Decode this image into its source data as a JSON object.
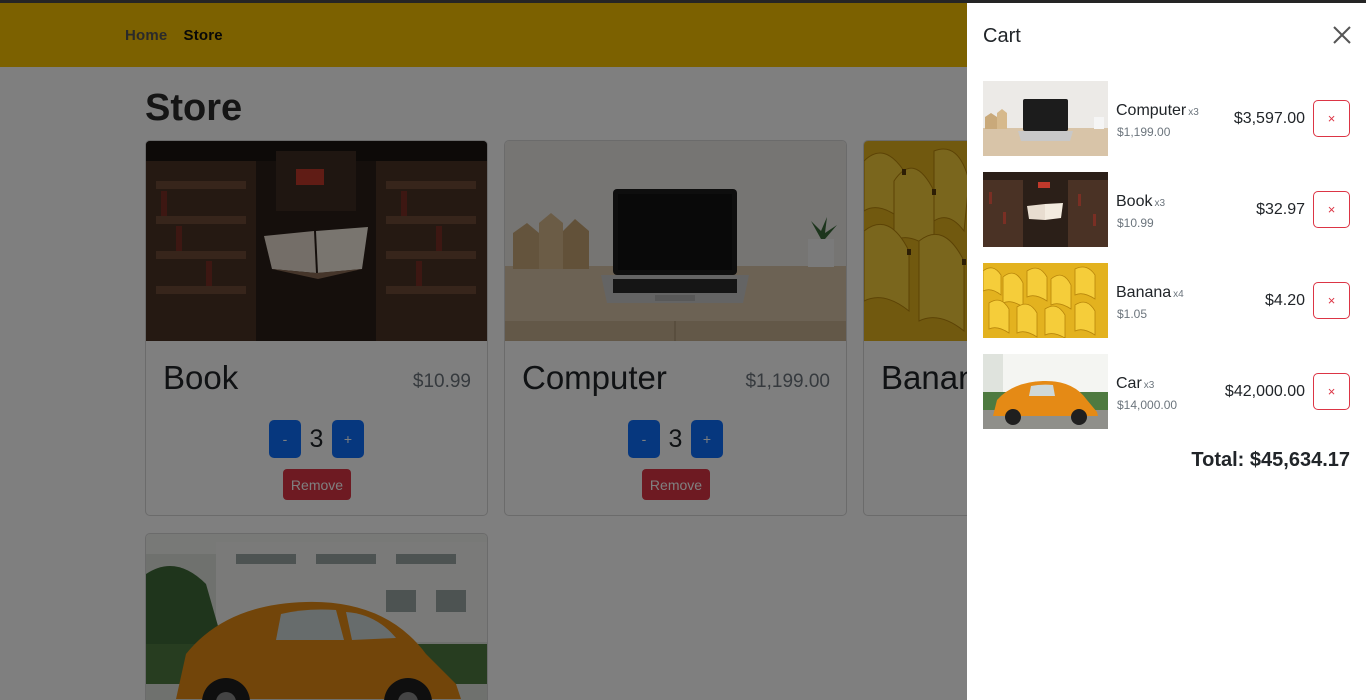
{
  "nav": {
    "links": [
      {
        "label": "Home"
      },
      {
        "label": "Store"
      }
    ]
  },
  "store": {
    "title": "Store",
    "remove_label": "Remove",
    "minus_label": "-",
    "plus_label": "+",
    "products": [
      {
        "name": "Book",
        "price": "$10.99",
        "quantity": "3"
      },
      {
        "name": "Computer",
        "price": "$1,199.00",
        "quantity": "3"
      },
      {
        "name": "Banana"
      },
      {
        "name": "Car"
      }
    ]
  },
  "cart": {
    "title": "Cart",
    "items": [
      {
        "name": "Computer",
        "qty": "x3",
        "unit_price": "$1,199.00",
        "total": "$3,597.00",
        "remove": "×"
      },
      {
        "name": "Book",
        "qty": "x3",
        "unit_price": "$10.99",
        "total": "$32.97",
        "remove": "×"
      },
      {
        "name": "Banana",
        "qty": "x4",
        "unit_price": "$1.05",
        "total": "$4.20",
        "remove": "×"
      },
      {
        "name": "Car",
        "qty": "x3",
        "unit_price": "$14,000.00",
        "total": "$42,000.00",
        "remove": "×"
      }
    ],
    "total": "Total: $45,634.17"
  },
  "colors": {
    "navbar": "#f8c300",
    "primary": "#0d6efd",
    "danger": "#dc3545"
  }
}
